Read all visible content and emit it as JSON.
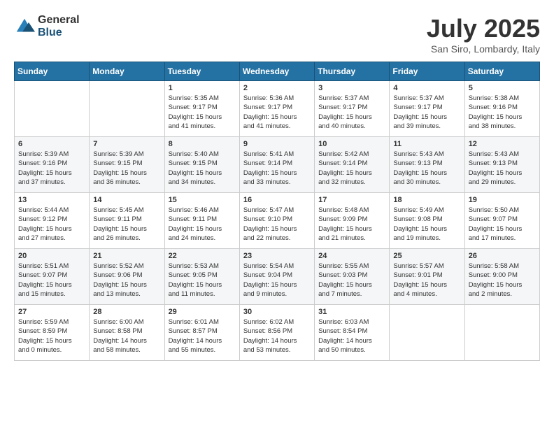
{
  "logo": {
    "general": "General",
    "blue": "Blue"
  },
  "title": "July 2025",
  "location": "San Siro, Lombardy, Italy",
  "weekdays": [
    "Sunday",
    "Monday",
    "Tuesday",
    "Wednesday",
    "Thursday",
    "Friday",
    "Saturday"
  ],
  "weeks": [
    [
      {
        "day": "",
        "info": ""
      },
      {
        "day": "",
        "info": ""
      },
      {
        "day": "1",
        "info": "Sunrise: 5:35 AM\nSunset: 9:17 PM\nDaylight: 15 hours\nand 41 minutes."
      },
      {
        "day": "2",
        "info": "Sunrise: 5:36 AM\nSunset: 9:17 PM\nDaylight: 15 hours\nand 41 minutes."
      },
      {
        "day": "3",
        "info": "Sunrise: 5:37 AM\nSunset: 9:17 PM\nDaylight: 15 hours\nand 40 minutes."
      },
      {
        "day": "4",
        "info": "Sunrise: 5:37 AM\nSunset: 9:17 PM\nDaylight: 15 hours\nand 39 minutes."
      },
      {
        "day": "5",
        "info": "Sunrise: 5:38 AM\nSunset: 9:16 PM\nDaylight: 15 hours\nand 38 minutes."
      }
    ],
    [
      {
        "day": "6",
        "info": "Sunrise: 5:39 AM\nSunset: 9:16 PM\nDaylight: 15 hours\nand 37 minutes."
      },
      {
        "day": "7",
        "info": "Sunrise: 5:39 AM\nSunset: 9:15 PM\nDaylight: 15 hours\nand 36 minutes."
      },
      {
        "day": "8",
        "info": "Sunrise: 5:40 AM\nSunset: 9:15 PM\nDaylight: 15 hours\nand 34 minutes."
      },
      {
        "day": "9",
        "info": "Sunrise: 5:41 AM\nSunset: 9:14 PM\nDaylight: 15 hours\nand 33 minutes."
      },
      {
        "day": "10",
        "info": "Sunrise: 5:42 AM\nSunset: 9:14 PM\nDaylight: 15 hours\nand 32 minutes."
      },
      {
        "day": "11",
        "info": "Sunrise: 5:43 AM\nSunset: 9:13 PM\nDaylight: 15 hours\nand 30 minutes."
      },
      {
        "day": "12",
        "info": "Sunrise: 5:43 AM\nSunset: 9:13 PM\nDaylight: 15 hours\nand 29 minutes."
      }
    ],
    [
      {
        "day": "13",
        "info": "Sunrise: 5:44 AM\nSunset: 9:12 PM\nDaylight: 15 hours\nand 27 minutes."
      },
      {
        "day": "14",
        "info": "Sunrise: 5:45 AM\nSunset: 9:11 PM\nDaylight: 15 hours\nand 26 minutes."
      },
      {
        "day": "15",
        "info": "Sunrise: 5:46 AM\nSunset: 9:11 PM\nDaylight: 15 hours\nand 24 minutes."
      },
      {
        "day": "16",
        "info": "Sunrise: 5:47 AM\nSunset: 9:10 PM\nDaylight: 15 hours\nand 22 minutes."
      },
      {
        "day": "17",
        "info": "Sunrise: 5:48 AM\nSunset: 9:09 PM\nDaylight: 15 hours\nand 21 minutes."
      },
      {
        "day": "18",
        "info": "Sunrise: 5:49 AM\nSunset: 9:08 PM\nDaylight: 15 hours\nand 19 minutes."
      },
      {
        "day": "19",
        "info": "Sunrise: 5:50 AM\nSunset: 9:07 PM\nDaylight: 15 hours\nand 17 minutes."
      }
    ],
    [
      {
        "day": "20",
        "info": "Sunrise: 5:51 AM\nSunset: 9:07 PM\nDaylight: 15 hours\nand 15 minutes."
      },
      {
        "day": "21",
        "info": "Sunrise: 5:52 AM\nSunset: 9:06 PM\nDaylight: 15 hours\nand 13 minutes."
      },
      {
        "day": "22",
        "info": "Sunrise: 5:53 AM\nSunset: 9:05 PM\nDaylight: 15 hours\nand 11 minutes."
      },
      {
        "day": "23",
        "info": "Sunrise: 5:54 AM\nSunset: 9:04 PM\nDaylight: 15 hours\nand 9 minutes."
      },
      {
        "day": "24",
        "info": "Sunrise: 5:55 AM\nSunset: 9:03 PM\nDaylight: 15 hours\nand 7 minutes."
      },
      {
        "day": "25",
        "info": "Sunrise: 5:57 AM\nSunset: 9:01 PM\nDaylight: 15 hours\nand 4 minutes."
      },
      {
        "day": "26",
        "info": "Sunrise: 5:58 AM\nSunset: 9:00 PM\nDaylight: 15 hours\nand 2 minutes."
      }
    ],
    [
      {
        "day": "27",
        "info": "Sunrise: 5:59 AM\nSunset: 8:59 PM\nDaylight: 15 hours\nand 0 minutes."
      },
      {
        "day": "28",
        "info": "Sunrise: 6:00 AM\nSunset: 8:58 PM\nDaylight: 14 hours\nand 58 minutes."
      },
      {
        "day": "29",
        "info": "Sunrise: 6:01 AM\nSunset: 8:57 PM\nDaylight: 14 hours\nand 55 minutes."
      },
      {
        "day": "30",
        "info": "Sunrise: 6:02 AM\nSunset: 8:56 PM\nDaylight: 14 hours\nand 53 minutes."
      },
      {
        "day": "31",
        "info": "Sunrise: 6:03 AM\nSunset: 8:54 PM\nDaylight: 14 hours\nand 50 minutes."
      },
      {
        "day": "",
        "info": ""
      },
      {
        "day": "",
        "info": ""
      }
    ]
  ]
}
